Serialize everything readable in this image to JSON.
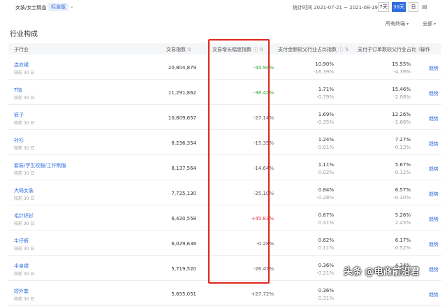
{
  "topbar": {
    "category": "女装/女士精品",
    "tag": "标准版",
    "stat": "统计时间 2021-07-21 ~ 2021-08-19",
    "ranges": [
      "7天",
      "30天",
      "日"
    ]
  },
  "section_title": "行业构成",
  "filters": {
    "terminal": "所有终端",
    "all": "全部"
  },
  "headers": {
    "sub": "子行业",
    "index": "交易指数",
    "growth": "交易增长幅度指数",
    "pay": "支付金额较父行业占比指数",
    "orders": "支付子订单数较父行业占比",
    "op": "操作"
  },
  "rows": [
    {
      "name": "连衣裙",
      "sub": "较前 30 日",
      "index": "20,804,879",
      "growth": "-44.94%",
      "pay": "10.90%",
      "pay_d": "-16.39%",
      "orders": "15.55%",
      "orders_d": "-4.39%",
      "op": "趋势",
      "color": "green"
    },
    {
      "name": "T恤",
      "sub": "较前 30 日",
      "index": "11,291,862",
      "growth": "-38.42%",
      "pay": "1.71%",
      "pay_d": "-0.79%",
      "orders": "15.46%",
      "orders_d": "-2.08%",
      "op": "趋势",
      "color": "green"
    },
    {
      "name": "裤子",
      "sub": "较前 30 日",
      "index": "10,809,657",
      "growth": "-27.14%",
      "pay": "1.69%",
      "pay_d": "-0.35%",
      "orders": "12.26%",
      "orders_d": "-1.68%",
      "op": "趋势",
      "color": "gray"
    },
    {
      "name": "衬衫",
      "sub": "较前 30 日",
      "index": "8,236,354",
      "growth": "-15.35%",
      "pay": "1.24%",
      "pay_d": "0.01%",
      "orders": "7.27%",
      "orders_d": "0.13%",
      "op": "趋势",
      "color": "gray"
    },
    {
      "name": "套装/学生校服/工作制服",
      "sub": "较前 30 日",
      "index": "8,137,564",
      "growth": "-14.64%",
      "pay": "1.11%",
      "pay_d": "0.02%",
      "orders": "5.67%",
      "orders_d": "0.12%",
      "op": "趋势",
      "color": "gray"
    },
    {
      "name": "大码女装",
      "sub": "较前 30 日",
      "index": "7,725,130",
      "growth": "-25.10%",
      "pay": "0.84%",
      "pay_d": "-0.28%",
      "orders": "6.57%",
      "orders_d": "-0.30%",
      "op": "趋势",
      "color": "gray"
    },
    {
      "name": "毛针织衫",
      "sub": "较前 30 日",
      "index": "6,420,558",
      "growth": "+45.83%",
      "pay": "0.67%",
      "pay_d": "0.31%",
      "orders": "5.26%",
      "orders_d": "2.45%",
      "op": "趋势",
      "color": "red"
    },
    {
      "name": "牛仔裤",
      "sub": "较前 30 日",
      "index": "6,029,638",
      "growth": "-0.28%",
      "pay": "0.62%",
      "pay_d": "0.11%",
      "orders": "6.17%",
      "orders_d": "0.52%",
      "op": "趋势",
      "color": "gray"
    },
    {
      "name": "半身裙",
      "sub": "较前 30 日",
      "index": "5,719,520",
      "growth": "-26.47%",
      "pay": "0.36%",
      "pay_d": "-0.21%",
      "orders": "4.34%",
      "orders_d": "-0.43%",
      "op": "趋势",
      "color": "gray"
    },
    {
      "name": "短外套",
      "sub": "较前 30 日",
      "index": "5,655,051",
      "growth": "+27.72%",
      "pay": "0.36%",
      "pay_d": "0.31%",
      "orders": "",
      "orders_d": "",
      "op": "趋势",
      "color": "gray"
    }
  ],
  "watermark": "头条 @电商前沿君"
}
